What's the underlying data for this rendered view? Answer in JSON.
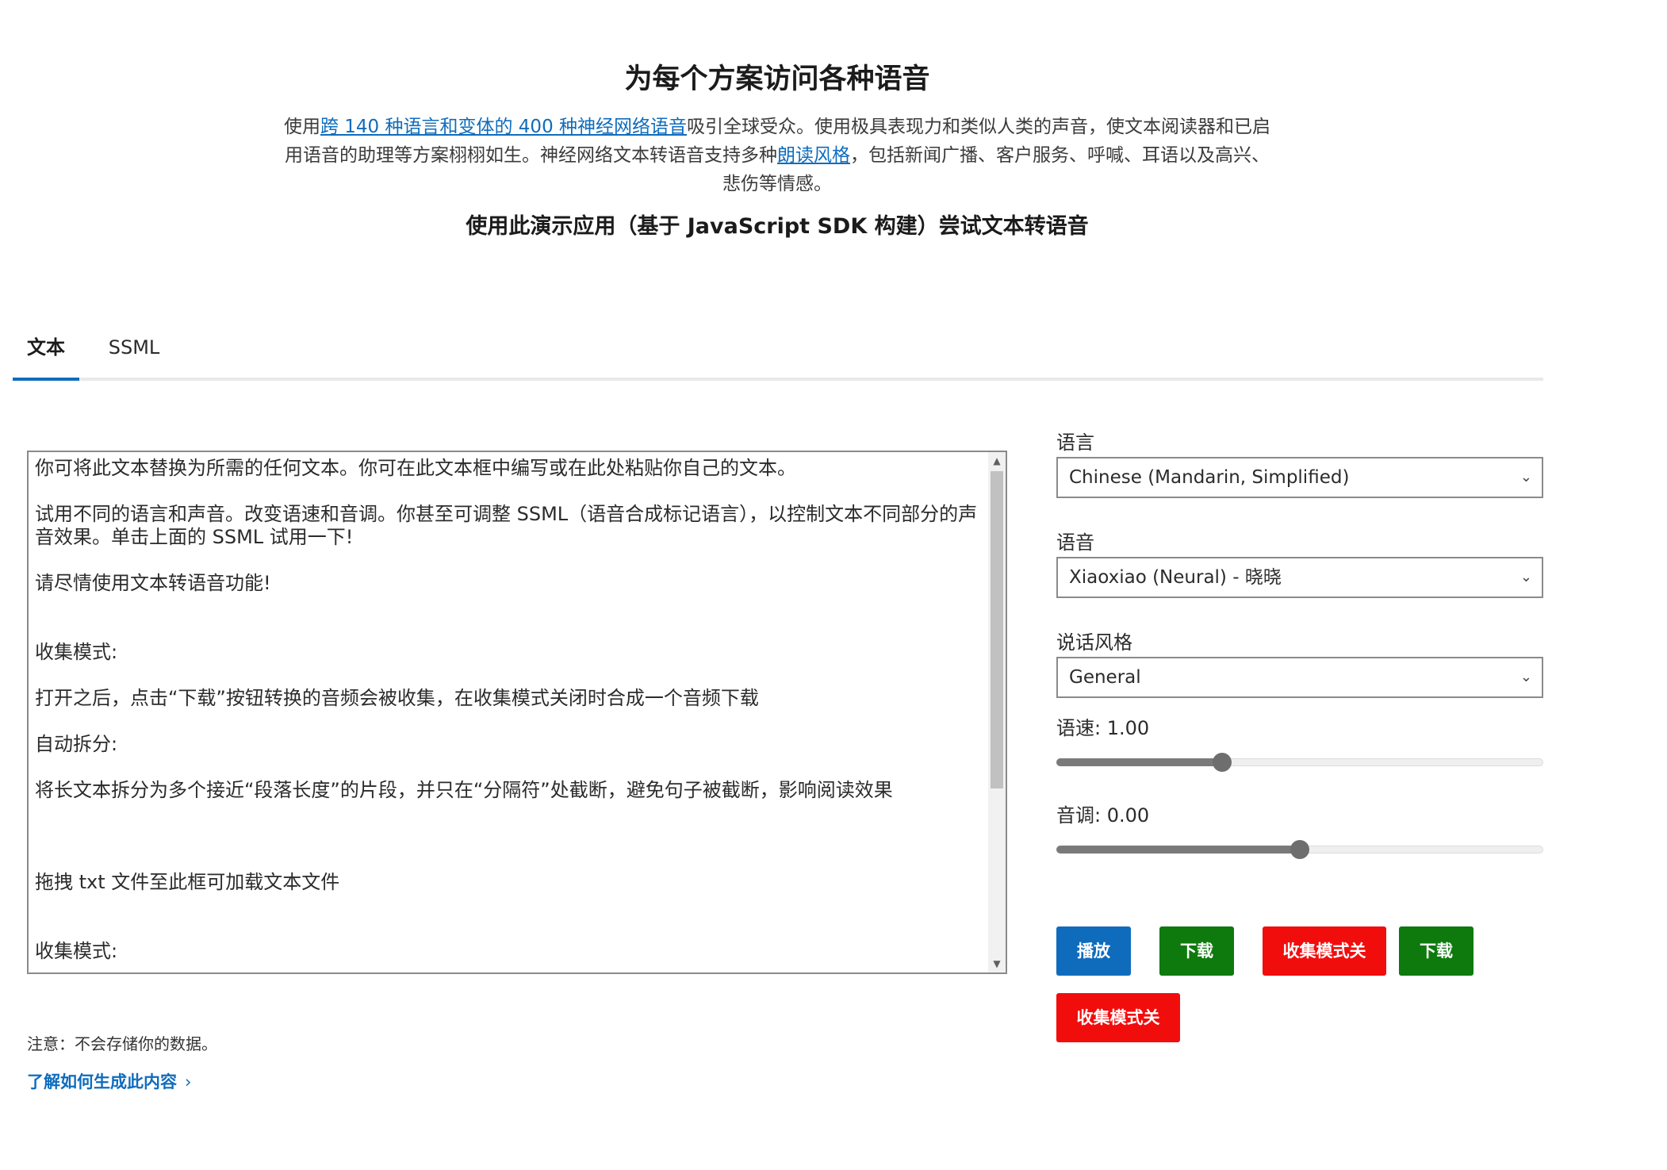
{
  "header": {
    "title": "为每个方案访问各种语音",
    "intro": {
      "part1": "使用",
      "link1": "跨 140 种语言和变体的 400 种神经网络语音",
      "part2": "吸引全球受众。使用极具表现力和类似人类的声音，使文本阅读器和已启用语音的助理等方案栩栩如生。神经网络文本转语音支持多种",
      "link2": "朗读风格",
      "part3": "，包括新闻广播、客户服务、呼喊、耳语以及高兴、悲伤等情感。"
    },
    "subtitle": "使用此演示应用（基于 JavaScript SDK 构建）尝试文本转语音"
  },
  "tabs": [
    {
      "label": "文本",
      "active": true
    },
    {
      "label": "SSML",
      "active": false
    }
  ],
  "editor": {
    "text": "你可将此文本替换为所需的任何文本。你可在此文本框中编写或在此处粘贴你自己的文本。\n\n试用不同的语言和声音。改变语速和音调。你甚至可调整 SSML（语音合成标记语言），以控制文本不同部分的声音效果。单击上面的 SSML 试用一下!\n\n请尽情使用文本转语音功能!\n\n\n收集模式:\n\n打开之后，点击“下载”按钮转换的音频会被收集，在收集模式关闭时合成一个音频下载\n\n自动拆分:\n\n将长文本拆分为多个接近“段落长度”的片段，并只在“分隔符”处截断，避免句子被截断，影响阅读效果\n\n\n\n拖拽 txt 文件至此框可加载文本文件\n\n\n收集模式:"
  },
  "footer": {
    "note": "注意：不会存储你的数据。",
    "learn_link": "了解如何生成此内容"
  },
  "controls": {
    "language_label": "语言",
    "language_value": "Chinese (Mandarin, Simplified)",
    "voice_label": "语音",
    "voice_value": "Xiaoxiao (Neural) - 晓晓",
    "style_label": "说话风格",
    "style_value": "General",
    "rate_label": "语速: 1.00",
    "rate_fraction": 0.34,
    "pitch_label": "音调: 0.00",
    "pitch_fraction": 0.5
  },
  "buttons": {
    "play": "播放",
    "download1": "下载",
    "collect_mode1": "收集模式关",
    "download2": "下载",
    "collect_mode2": "收集模式关"
  },
  "colors": {
    "accent": "#0f6cbd",
    "green": "#0e7a0d",
    "red": "#f20d0d"
  }
}
